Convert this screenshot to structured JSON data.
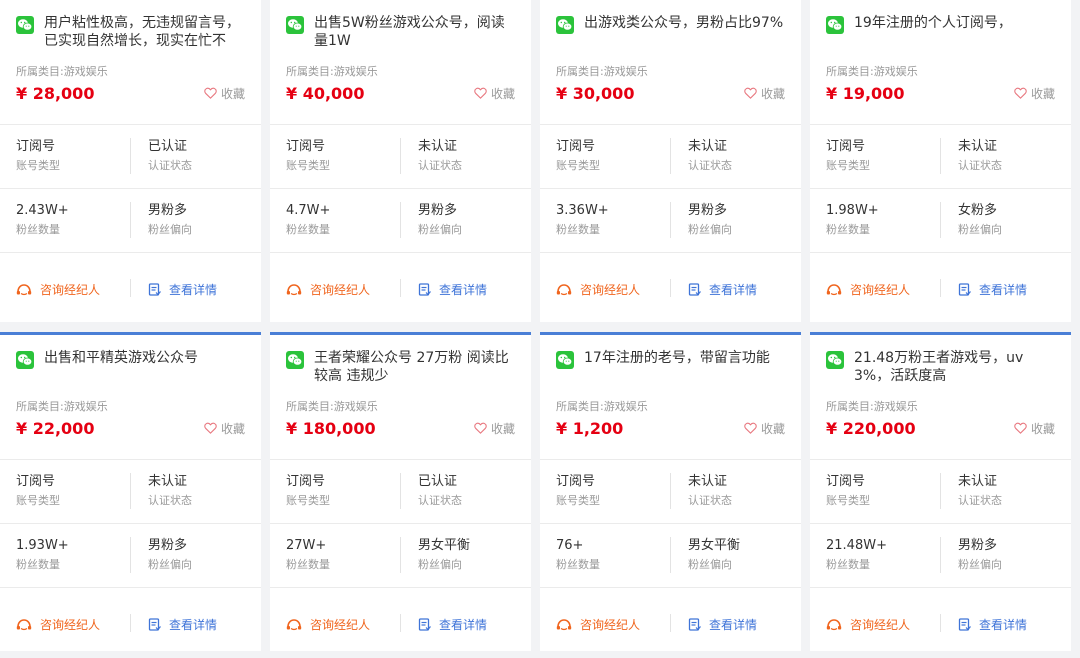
{
  "labels": {
    "category_prefix": "所属类目:",
    "favorite": "收藏",
    "account_type": "账号类型",
    "cert_status": "认证状态",
    "fans_count": "粉丝数量",
    "fans_bias": "粉丝偏向",
    "consult": "咨询经纪人",
    "detail": "查看详情"
  },
  "colors": {
    "price": "#e50012",
    "wechat": "#2bc33b",
    "consult": "#f0651e",
    "detail": "#3f74d8",
    "accent_border": "#4a7fd6"
  },
  "cards": [
    {
      "title": "用户粘性极高，无违规留言号，已实现自然增长，现实在忙不",
      "category": "游戏娱乐",
      "price": "¥ 28,000",
      "type": "订阅号",
      "cert": "已认证",
      "fans": "2.43W+",
      "bias": "男粉多"
    },
    {
      "title": "出售5W粉丝游戏公众号，阅读量1W",
      "category": "游戏娱乐",
      "price": "¥ 40,000",
      "type": "订阅号",
      "cert": "未认证",
      "fans": "4.7W+",
      "bias": "男粉多"
    },
    {
      "title": "出游戏类公众号，男粉占比97%",
      "category": "游戏娱乐",
      "price": "¥ 30,000",
      "type": "订阅号",
      "cert": "未认证",
      "fans": "3.36W+",
      "bias": "男粉多"
    },
    {
      "title": "19年注册的个人订阅号，",
      "category": "游戏娱乐",
      "price": "¥ 19,000",
      "type": "订阅号",
      "cert": "未认证",
      "fans": "1.98W+",
      "bias": "女粉多"
    },
    {
      "title": "出售和平精英游戏公众号",
      "category": "游戏娱乐",
      "price": "¥ 22,000",
      "type": "订阅号",
      "cert": "未认证",
      "fans": "1.93W+",
      "bias": "男粉多"
    },
    {
      "title": "王者荣耀公众号 27万粉 阅读比较高 违规少",
      "category": "游戏娱乐",
      "price": "¥ 180,000",
      "type": "订阅号",
      "cert": "已认证",
      "fans": "27W+",
      "bias": "男女平衡"
    },
    {
      "title": "17年注册的老号，带留言功能",
      "category": "游戏娱乐",
      "price": "¥ 1,200",
      "type": "订阅号",
      "cert": "未认证",
      "fans": "76+",
      "bias": "男女平衡"
    },
    {
      "title": "21.48万粉王者游戏号，uv3%，活跃度高",
      "category": "游戏娱乐",
      "price": "¥ 220,000",
      "type": "订阅号",
      "cert": "未认证",
      "fans": "21.48W+",
      "bias": "男粉多"
    }
  ]
}
